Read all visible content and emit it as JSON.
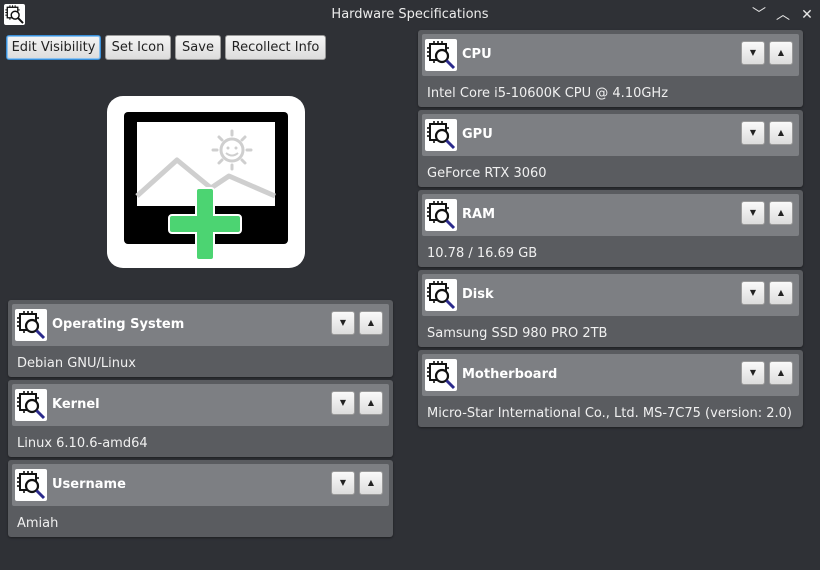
{
  "window": {
    "title": "Hardware Specifications",
    "minimize_glyph": "﹀",
    "maximize_glyph": "︿",
    "close_glyph": "✕"
  },
  "toolbar": {
    "edit_visibility": "Edit Visibility",
    "set_icon": "Set Icon",
    "save": "Save",
    "recollect_info": "Recollect Info"
  },
  "colors": {
    "background": "#2f3136",
    "card": "#5a5c60",
    "card_header": "#7d7f83",
    "plus": "#4cd472",
    "focus": "#3a8fd8"
  },
  "icons": {
    "app": "hardware-chip-magnifier-icon",
    "preview": "add-image-icon",
    "card": "hardware-chip-magnifier-icon",
    "arrow_down_glyph": "▼",
    "arrow_up_glyph": "▲"
  },
  "left_cards": [
    {
      "title": "Operating System",
      "value": "Debian GNU/Linux"
    },
    {
      "title": "Kernel",
      "value": "Linux 6.10.6-amd64"
    },
    {
      "title": "Username",
      "value": "Amiah"
    }
  ],
  "right_cards": [
    {
      "title": "CPU",
      "value": "Intel Core i5-10600K CPU @ 4.10GHz"
    },
    {
      "title": "GPU",
      "value": "GeForce RTX 3060"
    },
    {
      "title": "RAM",
      "value": "10.78 / 16.69 GB"
    },
    {
      "title": "Disk",
      "value": "Samsung SSD 980 PRO 2TB"
    },
    {
      "title": "Motherboard",
      "value": "Micro-Star International Co., Ltd. MS-7C75 (version: 2.0)"
    }
  ]
}
